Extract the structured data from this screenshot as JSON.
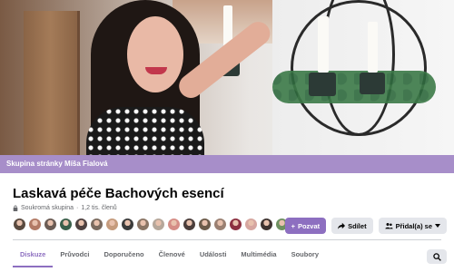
{
  "group_label": "Skupina stránky Míša Fialová",
  "title": "Laskavá péče Bachových esencí",
  "meta": {
    "privacy": "Soukromá skupina",
    "separator": "·",
    "members": "1,2 tis. členů"
  },
  "member_avatars": [
    "#5a4a3f",
    "#b27a65",
    "#6b5c54",
    "#3a5f4a",
    "#4f4140",
    "#7a6a5f",
    "#c59b7d",
    "#3b3b3b",
    "#8a7565",
    "#b6a79a",
    "#d58d86",
    "#4b3e3b",
    "#6c5b4a",
    "#9a8072",
    "#8c3040",
    "#d6a6a0",
    "#3e3330",
    "#6e9060"
  ],
  "buttons": {
    "invite": "Pozvat",
    "share": "Sdílet",
    "joined": "Přidal(a) se"
  },
  "tabs": [
    "Diskuze",
    "Průvodci",
    "Doporučeno",
    "Členové",
    "Události",
    "Multimédia",
    "Soubory"
  ],
  "active_tab": "Diskuze",
  "colors": {
    "accent": "#8d6fc0",
    "group_bar": "#a78ec9"
  },
  "icons": {
    "lock": "lock-icon",
    "plus": "plus-icon",
    "share": "share-arrow-icon",
    "people": "people-icon",
    "chevron": "chevron-down-icon",
    "search": "search-icon"
  }
}
